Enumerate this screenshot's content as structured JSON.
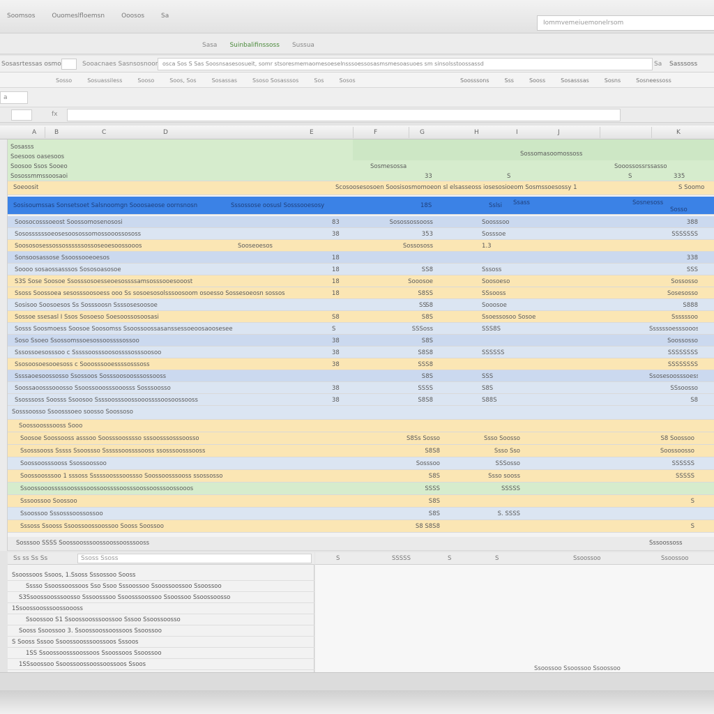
{
  "menu": [
    "Soomsos",
    "Ouomeslfloemsn",
    "Ooosos",
    "Sa"
  ],
  "search": {
    "placeholder": "Iommvemeiuemonelrsom"
  },
  "ribbon_tabs": [
    "Sasa",
    "Suinbalifinssoss",
    "Sussua"
  ],
  "address": {
    "label": "Sosasrtessas osmost",
    "label2": "Sooacnaes Sasnsosnoom",
    "url": "osca Sos S Sas Soosnsasesosueit, somr stsoresmemaomesoeselnsssoessosasmsmesoasuoes sm sinsolsstoossassd",
    "go": "Sa",
    "right": "Sasssoss"
  },
  "toolbar_left": [
    "Sosso",
    "Sosuassiless",
    "Sooso",
    "Soos, Sos",
    "Sosassas",
    "Ssoso Sosasssos",
    "Sos",
    "Sosos"
  ],
  "toolbar_right": [
    "Soosssons",
    "Sss",
    "Sooss",
    "Sosasssas",
    "Sosns",
    "Sosneessoss"
  ],
  "namebox": "a",
  "fx": "fx",
  "col_headers": [
    "A",
    "B",
    "C",
    "D",
    "E",
    "F",
    "G",
    "H",
    "I",
    "J",
    "K"
  ],
  "rows": {
    "r1": {
      "a": "Sosasss",
      "b": ""
    },
    "r2": {
      "a": "Soesoos oasesoos"
    },
    "r3": {
      "a": "Soosoo Ssos Sooeo",
      "x": "Sossomasoomossoss",
      "y": "Sooossossrssasso"
    },
    "r4": {
      "a": "Sosossmmssoosaoi",
      "p": "S",
      "q": "33",
      "s": "S",
      "t": "335"
    },
    "r5": {
      "a": "Soeoosit",
      "mid": "Scosoosesosoen  Soosisosmomoeon sl elsasseoss iosesosioeom  Sosmssoesossy  1",
      "k": "S  Soomo"
    },
    "sub_a": "Sosmesossa",
    "sub_b": "Sosnesoss",
    "sub_c": "Ssass",
    "head": {
      "a": "Sosisoumssas   Sonsetsoet  Salsnoomgn  Sooosaeose oornsnosn",
      "b": "Sssossose oosusl Sosssooesosy",
      "c": "18S",
      "d": "Sslsi",
      "e": "Sosso"
    }
  },
  "data_rows": [
    {
      "a": "Soosocosssoeost Soossomosenososi",
      "n": "83",
      "p": "Sosossossooss",
      "q": "Soosssoo",
      "k": "388"
    },
    {
      "a": "Sosossssssoeosesoosossomossooossososs",
      "n": "38",
      "p": "353",
      "q": "Sosssoe",
      "k": "SSSSSSS"
    },
    {
      "a": "Soosososessossossssssossoseoesoossooos",
      "m": "Sooseoesos",
      "n": "",
      "p": "Sossososs",
      "q": "1.3",
      "k": ""
    },
    {
      "a": "Sonsoosassose   Ssoossooeoesos",
      "n": "18",
      "p": "",
      "q": "",
      "k": "338"
    },
    {
      "a": "Soooo sosaossasssos  Sososoasosoe",
      "n": "18",
      "p": "SS8",
      "q": "Sssoss",
      "k": "SSS"
    },
    {
      "a": "S3S Sose Soosoe   Ssosssosoesseoesossssamsosssooesooost",
      "n": "18",
      "p": "Sooosoe",
      "q": "Soosoeso",
      "k": "Sossosso"
    },
    {
      "a": "Ssoss Soossoea sesosssoosoess ooo Ss sosoesosolsssoosoom osoesso Sossesoeosn sossos",
      "n": "18",
      "p": "S8SS",
      "q": "SSsooss",
      "k": "Sosesosso"
    },
    {
      "a": "Sosisoo Soosoesos Ss    Sosssoosn  Ssssosesoosoe",
      "n": "",
      "o": "SS",
      "p": "S8",
      "q": "Sooosoe",
      "k": "S888"
    },
    {
      "a": "Sossoe ssesasl  I Ssos   Sosoeso Soesoossosoosasi",
      "n": "S8",
      "p": "S8S",
      "q": "Ssoessosoo Sosoe",
      "k": "Ssssssoo"
    },
    {
      "a": "Sosss Soosmoess Soosoe  Soosomss Ssoossoossasanssessoeoosaoosesee",
      "n": "S",
      "p": "SSSoss",
      "q": "SSS8S",
      "k": "Ssssssoesssooos"
    },
    {
      "a": "Soso Ssoeo       Ssossomssoesossoossssossoo",
      "n": "38",
      "p": "S8S",
      "q": "",
      "k": "Soossosso"
    },
    {
      "a": "Sssossoesosssoo  c     Sssssoosssoosossssosssoosoo",
      "n": "38",
      "p": "S8S8",
      "q": "SSSSSS",
      "k": "SSSSSSSS"
    },
    {
      "a": "Ssosoosoesooesoss  c     Sooosssooessssosssoss",
      "n": "38",
      "p": "SSS8",
      "q": "",
      "k": "SSSSSSSS"
    },
    {
      "a": "Ssssaoesoossosso  Ssossoos Sosssoosoosssossooss",
      "n": "",
      "p": "S8S",
      "q": "SSS",
      "k": "Ssosesoosssoess"
    },
    {
      "a": "Soossaoosssooosso      Ssoossooosssooosss  Sosssoosso",
      "n": "38",
      "p": "SSSS",
      "q": "S8S",
      "k": "SSsoosso"
    },
    {
      "a": "Ssosssoss  Soosss  Ssoosoo  Ssssoosssoossooossssoosoossooss",
      "n": "38",
      "p": "S8S8",
      "q": "S88S",
      "k": "S8"
    }
  ],
  "group2": {
    "title": "Sosssoosso       Ssoosssoeo soosso  Soossoso",
    "sub": "Soossoosssooss  Sooo",
    "r1": {
      "a": "Soosoe Soossooss asssoo Soosssoosssso sssoosssosssoosso",
      "p": "S8Ss Sosso",
      "q": "Ssso Soosso",
      "k": "S8 Soossoo"
    },
    "r2": {
      "a": "Ssosssooss  Sssss  Ssoossso Ssssssoossssooss ssosssoosssooss",
      "p": "S8S8",
      "q": "Ssso Sso",
      "k": "Soossoosso"
    },
    "r3": {
      "a": "Soossoosssooss  Ssossoossoo",
      "p": "Sosssoo",
      "q": "SSSosso",
      "k": "SSSSSS"
    },
    "r4": {
      "a": "Soossoosssoo 1 sssoss  Sssssoosssoossso  Soossoosssooss ssossosso",
      "p": "S8S",
      "q": "Ssso sooss",
      "k": "SSSSS"
    },
    "r5": {
      "a": "Ssoossooosssssoossssoossoossssoosssoossoosssoossooos",
      "p": "SSSS",
      "q": "SSSSS",
      "k": ""
    },
    "r6": {
      "a": "Sssoossoo  Soossoo",
      "p": "S8S",
      "q": "",
      "k": "S"
    },
    "r7": {
      "a": "Ssoossoo  Sssosssoossossoo",
      "p": "S8S",
      "q": "S. SSSS",
      "k": ""
    },
    "r8": {
      "a": "Sssoss  Ssooss  Ssoossoossoossoo  Sooss  Soossoo",
      "p": "S8 S8S8",
      "q": "",
      "k": "S"
    },
    "foot": {
      "a": "Sosssoo  SSSS  Soossoosssoossoossoosssooss",
      "k": "Sssoossoss"
    }
  },
  "bottom_left": {
    "search_label": "Ss ss Ss   Ss",
    "search_value": "Ssoss Ssoss",
    "items": [
      "Ssoossoos  Ssoos,  1.Ssoss  Sssossoo  Sooss",
      "Sssso  Ssoossoossoos  Sso  Ssoo  Sssoossoo  Ssoossoossoo  Ssoossoo",
      "S3Ssoossoosssoosso  Sssoosssoo  Ssoosssoossoo  Ssoossoo  Ssoossoosso",
      "1Ssoossoosssoossoooss",
      "Ssoossoo  S1  Ssoossoosssoossoo  Sssoo  Ssoossoosso",
      "Sooss  Ssoossoo  3.  Ssoossoossoossoos  Ssoossoo",
      "S  Sooss  Sssoo  Ssoossoosssoossoos  Sssoos",
      "1SS  Ssoossoosssoossoos  Ssoossoos  Ssoossoo",
      "1SSsoossoo  Ssoossoossoossoossoos  Ssoos"
    ]
  },
  "bottom_right": {
    "hdr": [
      "S",
      "SSSSS",
      "S",
      "S",
      "Ssoossoo",
      "Ssoossoo"
    ],
    "caption": "Ssoossoo  Ssoossoo  Ssoossoo"
  }
}
